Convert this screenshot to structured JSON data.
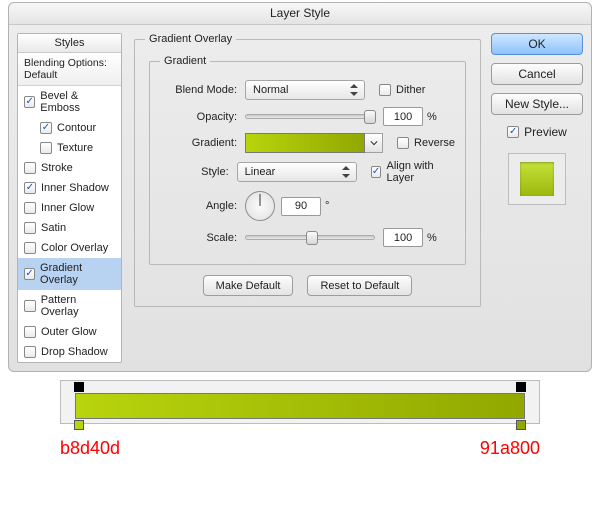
{
  "window_title": "Layer Style",
  "sidebar": {
    "heading": "Styles",
    "subheading": "Blending Options: Default",
    "items": [
      {
        "label": "Bevel & Emboss",
        "checked": true,
        "indent": false,
        "selected": false
      },
      {
        "label": "Contour",
        "checked": true,
        "indent": true,
        "selected": false
      },
      {
        "label": "Texture",
        "checked": false,
        "indent": true,
        "selected": false
      },
      {
        "label": "Stroke",
        "checked": false,
        "indent": false,
        "selected": false
      },
      {
        "label": "Inner Shadow",
        "checked": true,
        "indent": false,
        "selected": false
      },
      {
        "label": "Inner Glow",
        "checked": false,
        "indent": false,
        "selected": false
      },
      {
        "label": "Satin",
        "checked": false,
        "indent": false,
        "selected": false
      },
      {
        "label": "Color Overlay",
        "checked": false,
        "indent": false,
        "selected": false
      },
      {
        "label": "Gradient Overlay",
        "checked": true,
        "indent": false,
        "selected": true
      },
      {
        "label": "Pattern Overlay",
        "checked": false,
        "indent": false,
        "selected": false
      },
      {
        "label": "Outer Glow",
        "checked": false,
        "indent": false,
        "selected": false
      },
      {
        "label": "Drop Shadow",
        "checked": false,
        "indent": false,
        "selected": false
      }
    ]
  },
  "panel": {
    "group_title": "Gradient Overlay",
    "subgroup_title": "Gradient",
    "blend_mode_label": "Blend Mode:",
    "blend_mode_value": "Normal",
    "dither_label": "Dither",
    "dither_checked": false,
    "opacity_label": "Opacity:",
    "opacity_value": "100",
    "percent": "%",
    "gradient_label": "Gradient:",
    "reverse_label": "Reverse",
    "reverse_checked": false,
    "style_label": "Style:",
    "style_value": "Linear",
    "align_label": "Align with Layer",
    "align_checked": true,
    "angle_label": "Angle:",
    "angle_value": "90",
    "degree": "°",
    "scale_label": "Scale:",
    "scale_value": "100",
    "make_default": "Make Default",
    "reset_default": "Reset to Default"
  },
  "buttons": {
    "ok": "OK",
    "cancel": "Cancel",
    "new_style": "New Style...",
    "preview_label": "Preview",
    "preview_checked": true
  },
  "gradient_editor": {
    "left_color": "b8d40d",
    "right_color": "91a800"
  }
}
